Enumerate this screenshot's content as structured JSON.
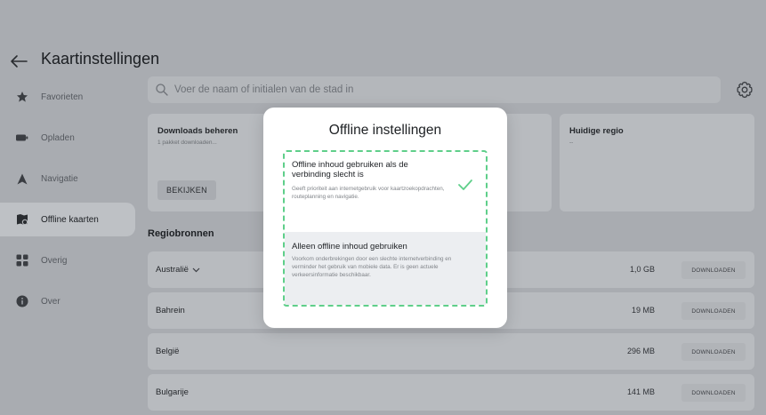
{
  "header": {
    "title": "Kaartinstellingen"
  },
  "sidebar": {
    "items": [
      {
        "label": "Favorieten",
        "icon": "star-icon"
      },
      {
        "label": "Opladen",
        "icon": "battery-icon"
      },
      {
        "label": "Navigatie",
        "icon": "navigation-arrow-icon"
      },
      {
        "label": "Offline kaarten",
        "icon": "offline-map-icon",
        "active": true
      },
      {
        "label": "Overig",
        "icon": "grid-icon"
      },
      {
        "label": "Over",
        "icon": "info-icon"
      }
    ]
  },
  "search": {
    "placeholder": "Voer de naam of initialen van de stad in"
  },
  "cards": {
    "downloads": {
      "title": "Downloads beheren",
      "subtitle": "1 pakket downloaden...",
      "button": "BEKIJKEN"
    },
    "region": {
      "title": "Huidige regio",
      "subtitle": "--"
    }
  },
  "regions": {
    "title": "Regiobronnen",
    "rows": [
      {
        "name": "Australië",
        "expandable": true,
        "size": "1,0 GB",
        "action": "DOWNLOADEN"
      },
      {
        "name": "Bahrein",
        "size": "19 MB",
        "action": "DOWNLOADEN"
      },
      {
        "name": "België",
        "size": "296 MB",
        "action": "DOWNLOADEN"
      },
      {
        "name": "Bulgarije",
        "size": "141 MB",
        "action": "DOWNLOADEN"
      }
    ]
  },
  "dialog": {
    "title": "Offline instellingen",
    "options": [
      {
        "title": "Offline inhoud gebruiken als de verbinding slecht is",
        "description": "Geeft prioriteit aan internetgebruik voor kaartzoekopdrachten, routeplanning en navigatie.",
        "selected": true
      },
      {
        "title": "Alleen offline inhoud gebruiken",
        "description": "Voorkom onderbrekingen door een slechte internetverbinding en verminder het gebruik van mobiele data. Er is geen actuele verkeersinformatie beschikbaar.",
        "selected": false
      }
    ]
  },
  "colors": {
    "accent": "#5fcf8a",
    "overlay": "#a9acb1"
  }
}
